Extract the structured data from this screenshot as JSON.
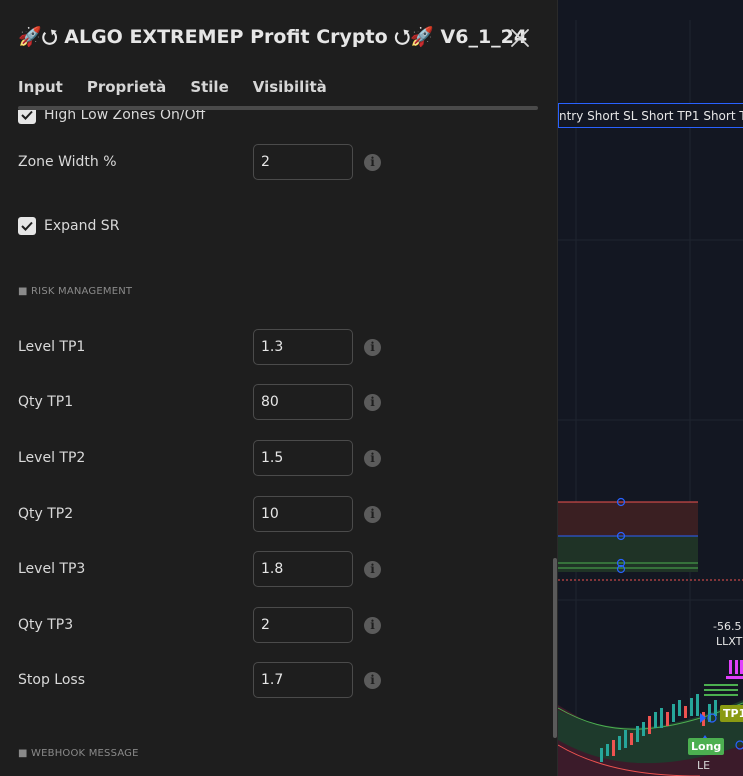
{
  "dialog": {
    "title": "🚀⭯ ALGO EXTREMEP Profit Crypto ⭯🚀 V6_1_24",
    "tabs": [
      "Input",
      "Proprietà",
      "Stile",
      "Visibilità"
    ]
  },
  "settings": {
    "high_low_zones_label": "High Low Zones On/Off",
    "high_low_zones_checked": true,
    "zone_width_label": "Zone Width %",
    "zone_width_value": "2",
    "expand_sr_label": "Expand SR",
    "expand_sr_checked": true,
    "risk_section": "■ RISK MANAGEMENT",
    "fields": [
      {
        "label": "Level TP1",
        "value": "1.3"
      },
      {
        "label": "Qty TP1",
        "value": "80"
      },
      {
        "label": "Level TP2",
        "value": "1.5"
      },
      {
        "label": "Qty TP2",
        "value": "10"
      },
      {
        "label": "Level TP3",
        "value": "1.8"
      },
      {
        "label": "Qty TP3",
        "value": "2"
      },
      {
        "label": "Stop Loss",
        "value": "1.7"
      }
    ],
    "webhook_section": "■ WEBHOOK MESSAGE"
  },
  "chart": {
    "banner": "ntry Short SL Short TP1 Short TP",
    "price_label": "-56.5",
    "strategy_label": "LLXT",
    "tp1_badge": "TP1",
    "long_badge": "Long",
    "le_label": "LE",
    "colors": {
      "background": "#131722",
      "tp_green": "#4caf50",
      "sl_red": "#ef5350",
      "blue": "#2962ff",
      "magenta": "#e040fb"
    }
  }
}
